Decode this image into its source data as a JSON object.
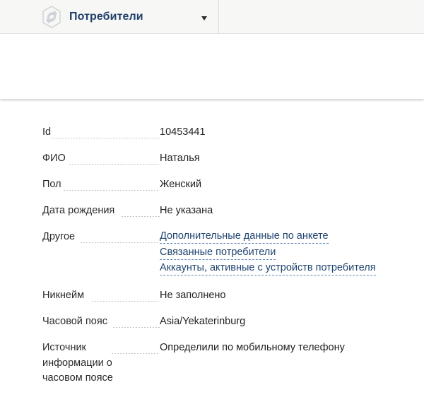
{
  "header": {
    "section_title": "Потребители",
    "logo_icon": "rotating-arrows-logo-icon",
    "dropdown_icon": "triangle-down-icon"
  },
  "colors": {
    "brand_text": "#20406a",
    "link": "#1e4470",
    "topbar_bg": "#f7f7f5"
  },
  "details": {
    "id": {
      "label": "Id",
      "value": "10453441"
    },
    "fio": {
      "label": "ФИО",
      "value": "Наталья"
    },
    "gender": {
      "label": "Пол",
      "value": "Женский"
    },
    "birthdate": {
      "label": "Дата рождения",
      "value": "Не указана"
    },
    "other": {
      "label": "Другое",
      "links": [
        "Дополнительные данные по анкете",
        "Связанные потребители",
        "Аккаунты, активные с устройств потребителя"
      ]
    },
    "nickname": {
      "label": "Никнейм",
      "value": "Не заполнено"
    },
    "timezone": {
      "label": "Часовой пояс",
      "value": "Asia/Yekaterinburg"
    },
    "timezone_source": {
      "label": "Источник информации о часовом поясе",
      "value": "Определили по мобильному телефону"
    }
  }
}
